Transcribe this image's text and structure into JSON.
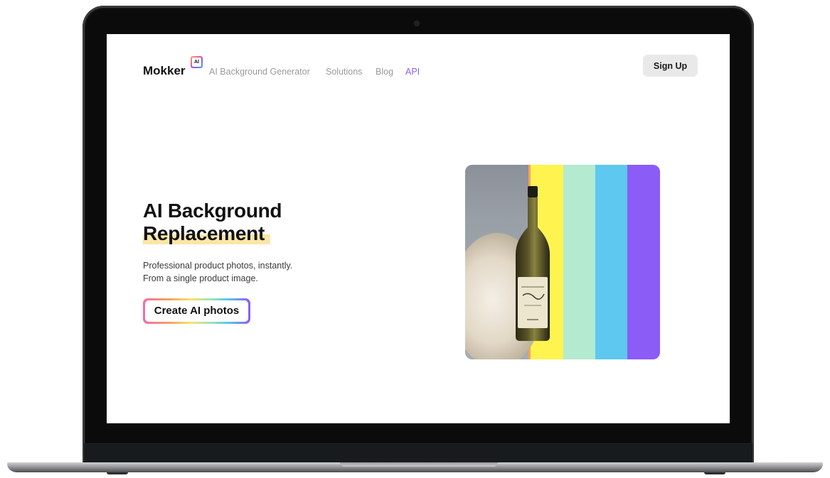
{
  "nav": {
    "logo": "Mokker",
    "logo_badge": "AI",
    "links": [
      "AI Background Generator",
      "Solutions",
      "Blog",
      "API"
    ],
    "signup": "Sign Up"
  },
  "hero": {
    "title_line1": "AI Background",
    "title_line2": "Replacement",
    "subtitle_line1": "Professional product photos, instantly.",
    "subtitle_line2": "From a single product image.",
    "cta": "Create AI photos"
  },
  "colors": {
    "accent": "#8b5cf6",
    "highlight": "#fbe6a7",
    "stripes": [
      "#fff44f",
      "#b4ead0",
      "#5ec8f0",
      "#8b5cf6"
    ]
  }
}
